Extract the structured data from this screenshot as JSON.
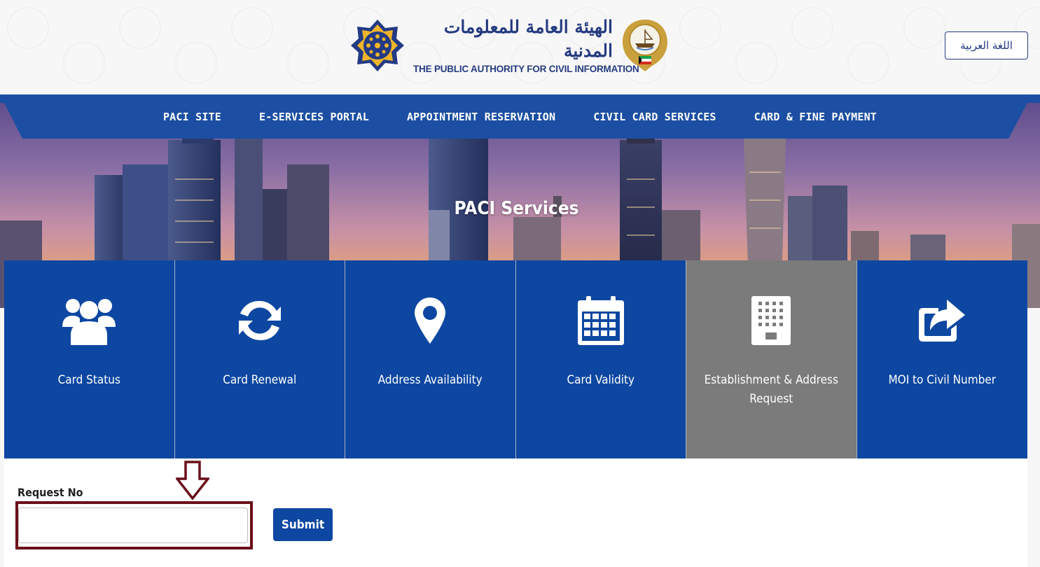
{
  "header": {
    "logo_arabic": "الهيئة العامة للمعلومات المدنية",
    "logo_english": "THE PUBLIC AUTHORITY FOR CIVIL INFORMATION",
    "language_button": "اللغة العربية"
  },
  "nav": {
    "items": [
      {
        "label": "PACI SITE"
      },
      {
        "label": "E-SERVICES PORTAL"
      },
      {
        "label": "APPOINTMENT RESERVATION"
      },
      {
        "label": "CIVIL CARD SERVICES"
      },
      {
        "label": "CARD & FINE PAYMENT"
      }
    ]
  },
  "hero": {
    "title": "PACI Services"
  },
  "tiles": [
    {
      "label": "Card Status",
      "icon": "users-icon"
    },
    {
      "label": "Card Renewal",
      "icon": "refresh-icon"
    },
    {
      "label": "Address Availability",
      "icon": "map-marker-icon"
    },
    {
      "label": "Card Validity",
      "icon": "calendar-icon"
    },
    {
      "label": "Establishment & Address Request",
      "icon": "building-icon",
      "active": true
    },
    {
      "label": "MOI to Civil Number",
      "icon": "share-icon"
    }
  ],
  "form": {
    "request_label": "Request No",
    "request_value": "",
    "submit_label": "Submit"
  },
  "colors": {
    "primary": "#0d47a1",
    "active_tile": "#7b7b7b",
    "highlight": "#6b0f1a"
  }
}
